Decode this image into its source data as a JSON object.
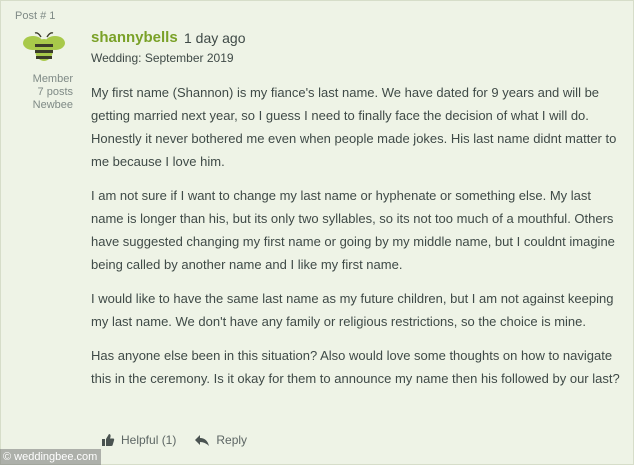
{
  "post": {
    "number_label": "Post # 1",
    "author": {
      "username": "shannybells",
      "time_ago": "1 day ago",
      "wedding_date": "Wedding: September 2019",
      "role": "Member",
      "posts": "7 posts",
      "rank": "Newbee",
      "avatar_icon": "bee-icon"
    },
    "paragraphs": [
      "My first name (Shannon) is my fiance's last name. We have dated for 9 years and will be getting married next year, so I guess I need to finally face the decision of what I will do. Honestly it never bothered me even when people made jokes. His last name didnt matter to me because I love him.",
      "I am not sure if I want to change my last name or hyphenate or something else. My last name is longer than his, but its only two syllables, so its not too much of a mouthful. Others have suggested changing my first name or going by my middle name, but I couldnt imagine being called by another name and I like my first name.",
      "I would like to have the same last name as my future children, but I am not against keeping my last name. We don't have any family or religious restrictions, so the choice is mine.",
      "Has anyone else been in this situation? Also would love some thoughts on how to navigate this in the ceremony. Is it okay for them to announce my name then his followed by our last?"
    ],
    "actions": {
      "helpful_label": "Helpful (1)",
      "reply_label": "Reply",
      "helpful_icon": "thumbs-up-icon",
      "reply_icon": "reply-arrow-icon"
    }
  },
  "watermark": "© weddingbee.com",
  "colors": {
    "background": "#eef3e6",
    "username": "#7aa128",
    "text": "#3f4a47",
    "muted": "#7f8a86"
  }
}
